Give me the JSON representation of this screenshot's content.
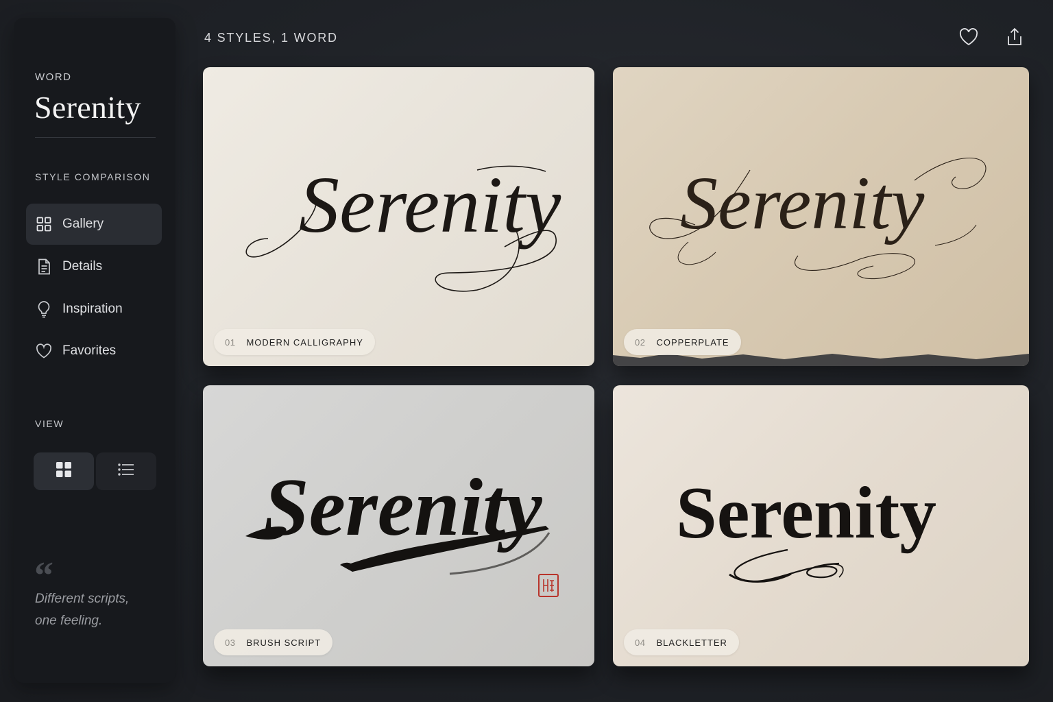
{
  "sidebar": {
    "word_label": "WORD",
    "word": "Serenity",
    "section_label": "STYLE COMPARISON",
    "nav": [
      {
        "label": "Gallery",
        "icon": "grid-icon",
        "active": true
      },
      {
        "label": "Details",
        "icon": "document-icon"
      },
      {
        "label": "Inspiration",
        "icon": "lightbulb-icon"
      },
      {
        "label": "Favorites",
        "icon": "heart-icon"
      }
    ],
    "view_label": "VIEW",
    "view_options": [
      {
        "icon": "grid-view-icon",
        "active": true
      },
      {
        "icon": "list-view-icon",
        "active": false
      }
    ],
    "quote_mark": "“",
    "quote": "Different scripts, one feeling."
  },
  "header": {
    "title": "4 STYLES, 1 WORD",
    "actions": [
      {
        "icon": "heart-icon"
      },
      {
        "icon": "share-icon"
      }
    ]
  },
  "cards": [
    {
      "number": "01",
      "name": "MODERN CALLIGRAPHY",
      "word": "Serenity"
    },
    {
      "number": "02",
      "name": "COPPERPLATE",
      "word": "Serenity"
    },
    {
      "number": "03",
      "name": "BRUSH SCRIPT",
      "word": "Serenity"
    },
    {
      "number": "04",
      "name": "BLACKLETTER",
      "word": "Serenity"
    }
  ],
  "colors": {
    "background": "#1f2227",
    "sidebar": "#17191d",
    "active_nav": "#2a2d33",
    "ink": "#1c1815",
    "seal_red": "#b8342b"
  }
}
